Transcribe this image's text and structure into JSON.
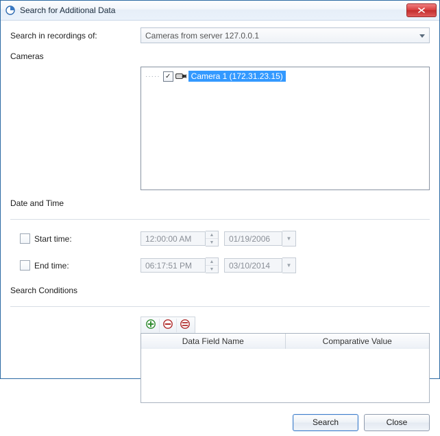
{
  "window": {
    "title": "Search for Additional Data"
  },
  "searchIn": {
    "label": "Search in recordings of:",
    "value": "Cameras from server 127.0.0.1"
  },
  "cameras": {
    "groupLabel": "Cameras",
    "items": [
      {
        "checked": true,
        "label": "Camera 1 (172.31.23.15)",
        "selected": true
      }
    ]
  },
  "dateTime": {
    "groupLabel": "Date and Time",
    "start": {
      "label": "Start time:",
      "checked": false,
      "time": "12:00:00 AM",
      "date": "01/19/2006"
    },
    "end": {
      "label": "End time:",
      "checked": false,
      "time": "06:17:51 PM",
      "date": "03/10/2014"
    }
  },
  "conditions": {
    "groupLabel": "Search Conditions",
    "columns": {
      "field": "Data Field Name",
      "value": "Comparative Value"
    },
    "rows": []
  },
  "buttons": {
    "search": "Search",
    "close": "Close"
  }
}
